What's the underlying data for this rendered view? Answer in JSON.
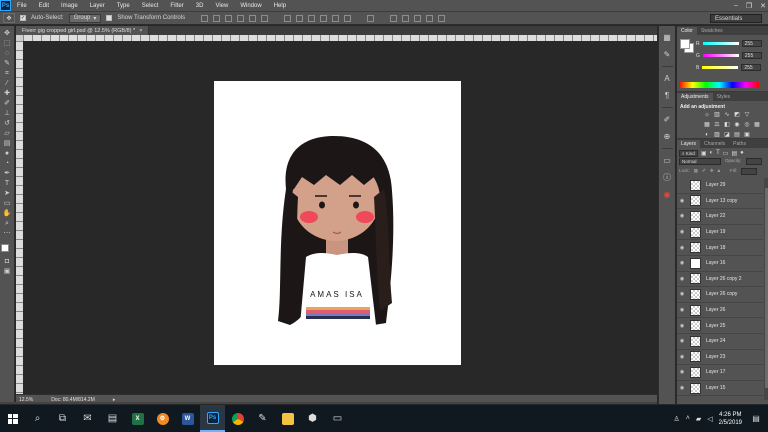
{
  "app": {
    "logo": "Ps",
    "menu": [
      "File",
      "Edit",
      "Image",
      "Layer",
      "Type",
      "Select",
      "Filter",
      "3D",
      "View",
      "Window",
      "Help"
    ],
    "window_controls": [
      "minimize-icon",
      "restore-icon",
      "close-icon"
    ]
  },
  "options": {
    "auto_select_label": "Auto-Select:",
    "auto_select_checked": true,
    "auto_select_value": "Group",
    "transform_label": "Show Transform Controls",
    "workspace": "Essentials"
  },
  "document": {
    "tab_title": "Fiverr gig cropped girl.psd @ 12.5% (RGB/8) *",
    "close_glyph": "×",
    "zoom": "12.5%",
    "doc_size": "Doc: 80.4M/814.2M",
    "canvas_bg": "#ffffff",
    "shirt_text": "AMAS ISA"
  },
  "tools": [
    "move",
    "marquee",
    "lasso",
    "quick-select",
    "crop",
    "eyedropper",
    "healing",
    "brush",
    "stamp",
    "history-brush",
    "eraser",
    "gradient",
    "blur",
    "dodge",
    "pen",
    "type",
    "path-select",
    "shape",
    "hand",
    "zoom"
  ],
  "color_panel": {
    "tabs": [
      "Color",
      "Swatches"
    ],
    "channels": [
      {
        "label": "R",
        "value": "255",
        "gradient": "linear-gradient(90deg,#00ffff,#ffffff)"
      },
      {
        "label": "G",
        "value": "255",
        "gradient": "linear-gradient(90deg,#ff00ff,#ffffff)"
      },
      {
        "label": "B",
        "value": "255",
        "gradient": "linear-gradient(90deg,#ffff00,#ffffff)"
      }
    ]
  },
  "adjustments_panel": {
    "tabs": [
      "Adjustments",
      "Styles"
    ],
    "title": "Add an adjustment"
  },
  "layers_panel": {
    "tabs": [
      "Layers",
      "Channels",
      "Paths"
    ],
    "kind_label": "Kind",
    "blend_mode": "Normal",
    "opacity_label": "Opacity:",
    "lock_label": "Lock:",
    "fill_label": "Fill:",
    "layers": [
      "Layer 29",
      "Layer 13 copy",
      "Layer 22",
      "Layer 19",
      "Layer 18",
      "Layer 16",
      "Layer 26 copy 2",
      "Layer 26 copy",
      "Layer 26",
      "Layer 25",
      "Layer 24",
      "Layer 23",
      "Layer 17",
      "Layer 15"
    ]
  },
  "taskbar": {
    "time": "4:26 PM",
    "date": "2/5/2019"
  },
  "colors": {
    "ui_dark": "#282828",
    "ui_panel": "#535353",
    "hair": "#1c1616",
    "skin": "#d3a08a",
    "blush": "#f04a5a",
    "accent": "#31a8ff"
  }
}
